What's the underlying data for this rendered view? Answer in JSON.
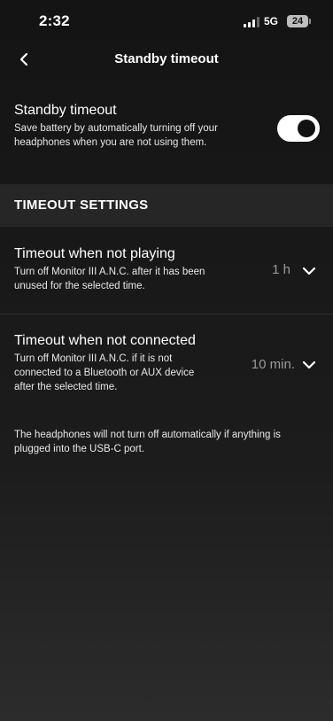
{
  "status_bar": {
    "time": "2:32",
    "network": "5G",
    "battery": "24"
  },
  "header": {
    "title": "Standby timeout",
    "back_icon": "chevron-left-icon"
  },
  "standby": {
    "title": "Standby timeout",
    "description": "Save battery by automatically turning off your headphones when you are not using them.",
    "toggle_on": true
  },
  "timeout_settings": {
    "section_label": "TIMEOUT SETTINGS",
    "rows": [
      {
        "title": "Timeout when not playing",
        "description": "Turn off Monitor III A.N.C. after it has been unused for the selected time.",
        "value": "1 h"
      },
      {
        "title": "Timeout when not connected",
        "description": "Turn off Monitor III A.N.C. if it is not connected to a Bluetooth or AUX device after the selected time.",
        "value": "10 min."
      }
    ]
  },
  "footer_note": "The headphones will not turn off automatically if anything is plugged into the USB-C port.",
  "colors": {
    "background": "#141414",
    "section_header": "#262626",
    "toggle_track": "#ffffff",
    "toggle_knob": "#111111",
    "value_text": "#9a9a9a"
  }
}
